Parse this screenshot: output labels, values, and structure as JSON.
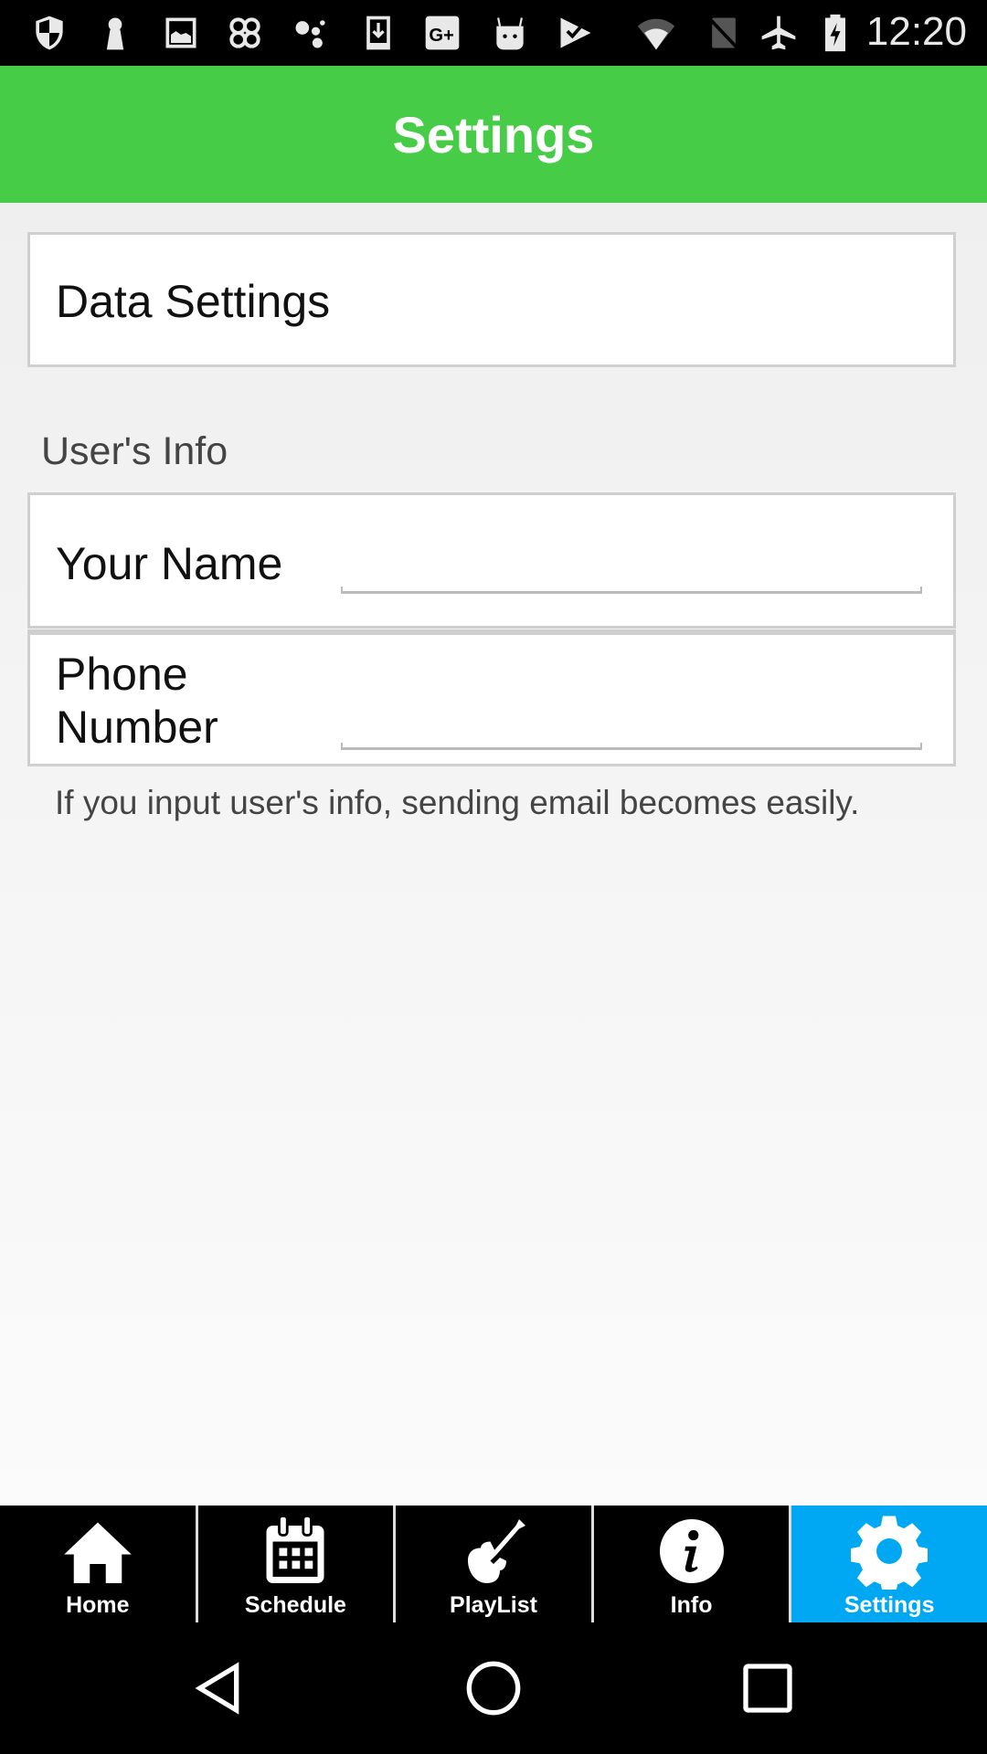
{
  "status_bar": {
    "time": "12:20",
    "left_icons": [
      "shield-icon",
      "keyhole-icon",
      "image-icon",
      "clover-icon",
      "assistant-icon",
      "download-icon",
      "google-plus-icon",
      "android-icon",
      "play-tasks-icon"
    ],
    "right_icons": [
      "wifi-icon",
      "no-sim-icon",
      "airplane-icon",
      "battery-charging-icon"
    ]
  },
  "app_bar": {
    "title": "Settings",
    "color": "#46cc46"
  },
  "data_settings": {
    "label": "Data Settings"
  },
  "users_info": {
    "section_label": "User's Info",
    "fields": [
      {
        "label": "Your Name",
        "value": "",
        "placeholder": ""
      },
      {
        "label": "Phone Number",
        "value": "",
        "placeholder": ""
      }
    ],
    "hint": "If you input user's info, sending email becomes easily."
  },
  "tab_bar": {
    "active_color": "#00a8f3",
    "tabs": [
      {
        "label": "Home",
        "icon": "home-icon",
        "active": false
      },
      {
        "label": "Schedule",
        "icon": "calendar-icon",
        "active": false
      },
      {
        "label": "PlayList",
        "icon": "guitar-icon",
        "active": false
      },
      {
        "label": "Info",
        "icon": "info-icon",
        "active": false
      },
      {
        "label": "Settings",
        "icon": "gear-icon",
        "active": true
      }
    ]
  },
  "nav_bar": {
    "buttons": [
      "back-icon",
      "home-circle-icon",
      "recents-icon"
    ]
  }
}
